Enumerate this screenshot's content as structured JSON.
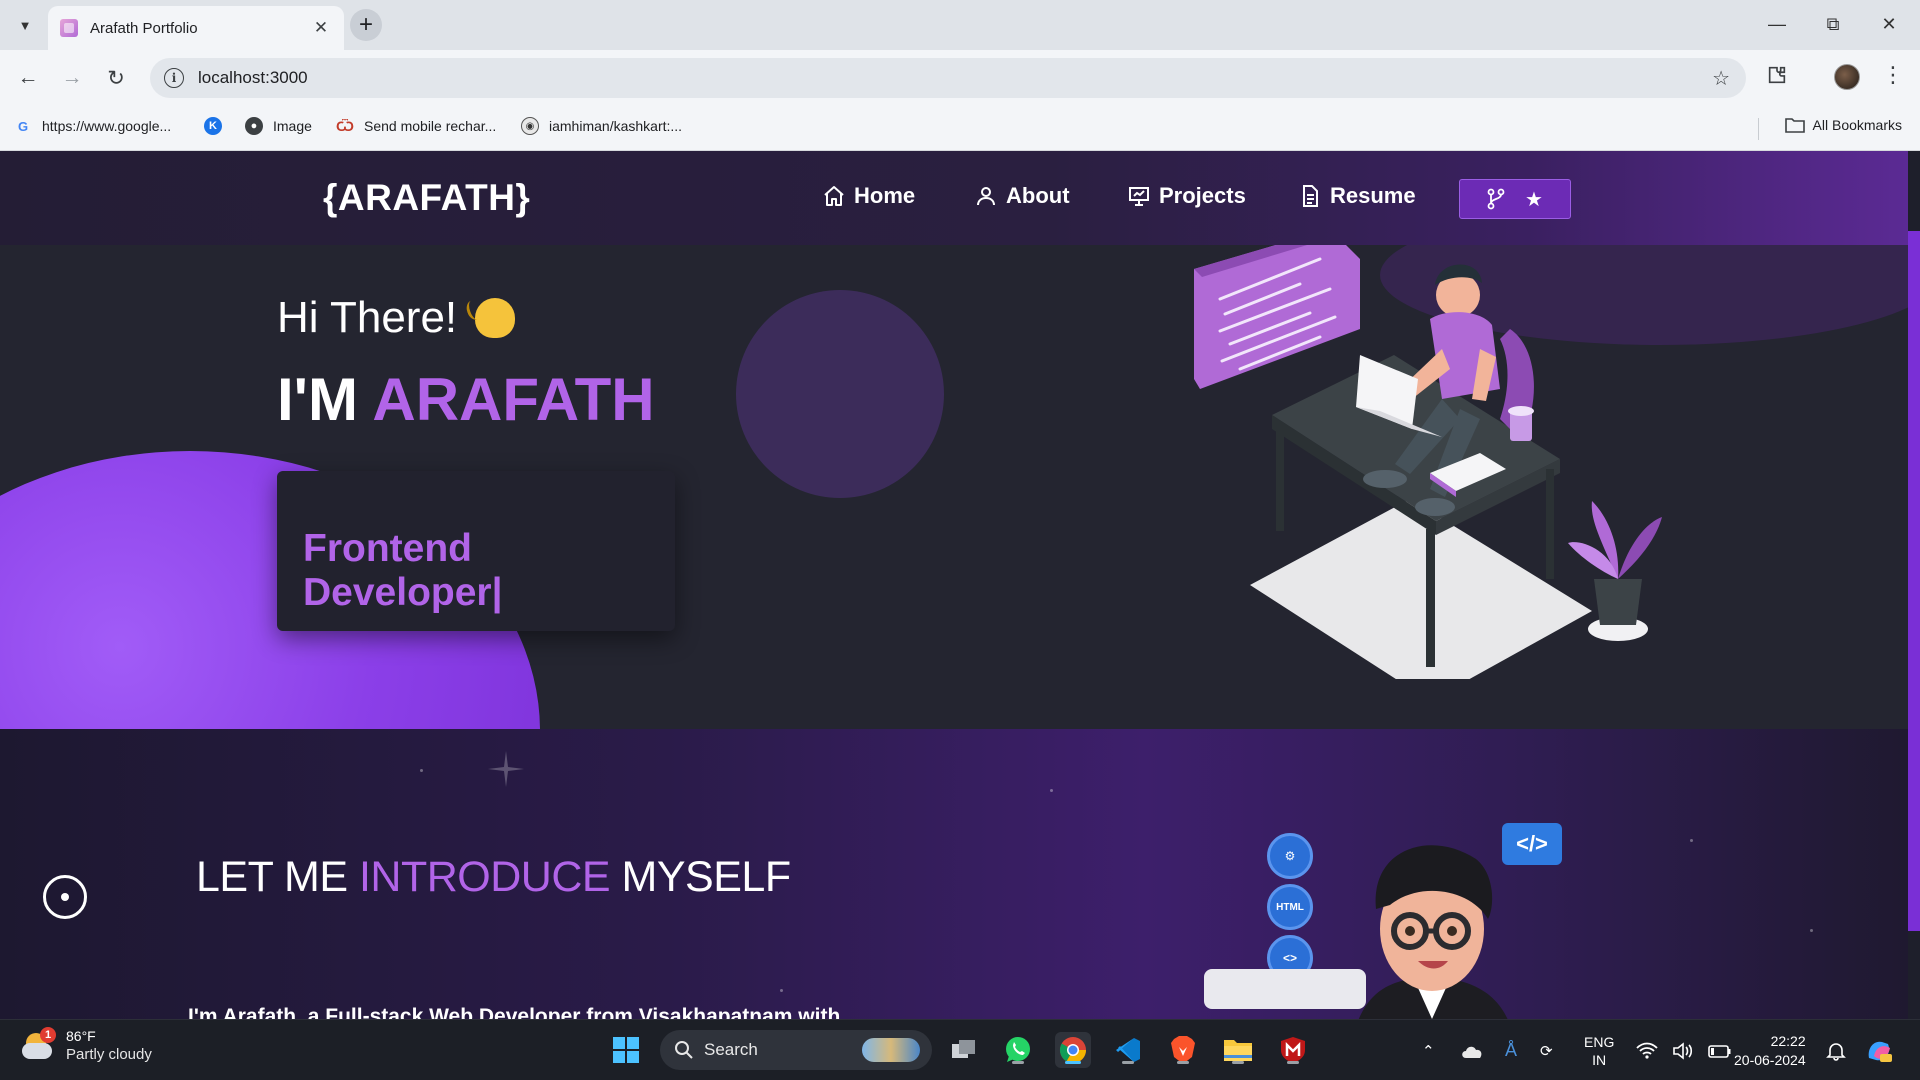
{
  "browser": {
    "tab_title": "Arafath Portfolio",
    "url": "localhost:3000",
    "bookmarks": [
      {
        "label": "https://www.google...",
        "icon": "google-icon"
      },
      {
        "label": "",
        "icon": "blue-k-icon"
      },
      {
        "label": "Image",
        "icon": "globe-icon"
      },
      {
        "label": "Send mobile rechar...",
        "icon": "paytm-icon"
      },
      {
        "label": "iamhiman/kashkart:...",
        "icon": "github-icon"
      }
    ],
    "all_bookmarks": "All Bookmarks"
  },
  "site": {
    "logo": "{ARAFATH}",
    "nav": [
      {
        "label": "Home",
        "icon": "home-icon"
      },
      {
        "label": "About",
        "icon": "user-icon"
      },
      {
        "label": "Projects",
        "icon": "presentation-icon"
      },
      {
        "label": "Resume",
        "icon": "document-icon"
      }
    ],
    "github_button": {
      "icons": [
        "git-fork-icon",
        "star-icon"
      ]
    }
  },
  "hero": {
    "greeting": "Hi There!",
    "iam_prefix": "I'M",
    "name": "ARAFATH",
    "role": "Frontend Developer|"
  },
  "about": {
    "title_part1": "LET ME",
    "title_accent": "INTRODUCE",
    "title_part2": "MYSELF",
    "intro": "I'm Arafath, a Full-stack Web Developer from Visakhapatnam with",
    "bubbles": [
      "gear-icon",
      "HTML",
      "code-icon"
    ],
    "code_badge": "</>"
  },
  "taskbar": {
    "weather": {
      "temp": "86°F",
      "desc": "Partly cloudy",
      "badge": "1"
    },
    "search_placeholder": "Search",
    "lang": "ENG",
    "region": "IN",
    "time": "22:22",
    "date": "20-06-2024"
  },
  "colors": {
    "accent_purple": "#b164e8",
    "hero_bg": "#242530",
    "navbar_start": "#241d35"
  }
}
